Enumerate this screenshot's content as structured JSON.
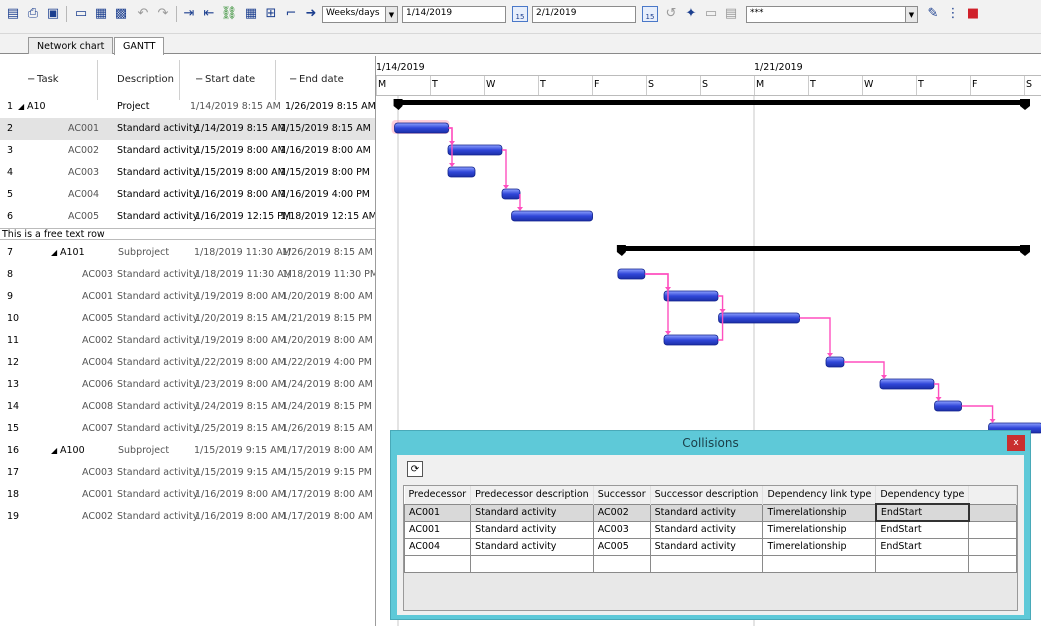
{
  "toolbar": {
    "icons": [
      "save-icon",
      "print-icon",
      "export-icon",
      "print-preview-icon",
      "page-setup-icon",
      "image-export-icon",
      "undo-icon",
      "redo-icon",
      "indent-icon",
      "outdent-icon",
      "link-icon",
      "table-icon",
      "network-icon",
      "dependency-icon",
      "arrow-icon"
    ],
    "timescale_value": "Weeks/days",
    "start_date": "1/14/2019",
    "end_date": "2/1/2019",
    "calendar_day": "15",
    "filter_value": "***"
  },
  "tabs": [
    {
      "label": "Network chart"
    },
    {
      "label": "GANTT"
    }
  ],
  "table": {
    "headers": {
      "task": "Task",
      "description": "Description",
      "start": "Start date",
      "end": "End date"
    },
    "rows": [
      {
        "num": "1",
        "task": "A10",
        "desc": "Project",
        "start": "1/14/2019 8:15 AM",
        "end": "1/26/2019 8:15 AM"
      },
      {
        "num": "2",
        "task": "AC001",
        "desc": "Standard activity",
        "start": "1/14/2019 8:15 AM",
        "end": "1/15/2019 8:15 AM"
      },
      {
        "num": "3",
        "task": "AC002",
        "desc": "Standard activity",
        "start": "1/15/2019 8:00 AM",
        "end": "1/16/2019 8:00 AM"
      },
      {
        "num": "4",
        "task": "AC003",
        "desc": "Standard activity",
        "start": "1/15/2019 8:00 AM",
        "end": "1/15/2019 8:00 PM"
      },
      {
        "num": "5",
        "task": "AC004",
        "desc": "Standard activity",
        "start": "1/16/2019 8:00 AM",
        "end": "1/16/2019 4:00 PM"
      },
      {
        "num": "6",
        "task": "AC005",
        "desc": "Standard activity",
        "start": "1/16/2019 12:15 PM",
        "end": "1/18/2019 12:15 AM"
      },
      {
        "num": "7",
        "task": "A101",
        "desc": "Subproject",
        "start": "1/18/2019 11:30 AM",
        "end": "1/26/2019 8:15 AM"
      },
      {
        "num": "8",
        "task": "AC003",
        "desc": "Standard activity",
        "start": "1/18/2019 11:30 AM",
        "end": "1/18/2019 11:30 PM"
      },
      {
        "num": "9",
        "task": "AC001",
        "desc": "Standard activity",
        "start": "1/19/2019 8:00 AM",
        "end": "1/20/2019 8:00 AM"
      },
      {
        "num": "10",
        "task": "AC005",
        "desc": "Standard activity",
        "start": "1/20/2019 8:15 AM",
        "end": "1/21/2019 8:15 PM"
      },
      {
        "num": "11",
        "task": "AC002",
        "desc": "Standard activity",
        "start": "1/19/2019 8:00 AM",
        "end": "1/20/2019 8:00 AM"
      },
      {
        "num": "12",
        "task": "AC004",
        "desc": "Standard activity",
        "start": "1/22/2019 8:00 AM",
        "end": "1/22/2019 4:00 PM"
      },
      {
        "num": "13",
        "task": "AC006",
        "desc": "Standard activity",
        "start": "1/23/2019 8:00 AM",
        "end": "1/24/2019 8:00 AM"
      },
      {
        "num": "14",
        "task": "AC008",
        "desc": "Standard activity",
        "start": "1/24/2019 8:15 AM",
        "end": "1/24/2019 8:15 PM"
      },
      {
        "num": "15",
        "task": "AC007",
        "desc": "Standard activity",
        "start": "1/25/2019 8:15 AM",
        "end": "1/26/2019 8:15 AM"
      },
      {
        "num": "16",
        "task": "A100",
        "desc": "Subproject",
        "start": "1/15/2019 9:15 AM",
        "end": "1/17/2019 8:00 AM"
      },
      {
        "num": "17",
        "task": "AC003",
        "desc": "Standard activity",
        "start": "1/15/2019 9:15 AM",
        "end": "1/15/2019 9:15 PM"
      },
      {
        "num": "18",
        "task": "AC001",
        "desc": "Standard activity",
        "start": "1/16/2019 8:00 AM",
        "end": "1/17/2019 8:00 AM"
      },
      {
        "num": "19",
        "task": "AC002",
        "desc": "Standard activity",
        "start": "1/16/2019 8:00 AM",
        "end": "1/17/2019 8:00 AM"
      }
    ],
    "free_text_row": "This is a free text row"
  },
  "timescale": {
    "weeks": [
      "1/14/2019",
      "1/21/2019"
    ],
    "days": [
      "M",
      "T",
      "W",
      "T",
      "F",
      "S",
      "S",
      "M",
      "T",
      "W",
      "T",
      "F",
      "S"
    ]
  },
  "collisions": {
    "title": "Collisions",
    "close_label": "x",
    "headers": [
      "Predecessor",
      "Predecessor description",
      "Successor",
      "Successor description",
      "Dependency link type",
      "Dependency type"
    ],
    "rows": [
      [
        "AC001",
        "Standard activity",
        "AC002",
        "Standard activity",
        "Timerelationship",
        "EndStart"
      ],
      [
        "AC001",
        "Standard activity",
        "AC003",
        "Standard activity",
        "Timerelationship",
        "EndStart"
      ],
      [
        "AC004",
        "Standard activity",
        "AC005",
        "Standard activity",
        "Timerelationship",
        "EndStart"
      ]
    ]
  },
  "colors": {
    "bar_fill": "#3047d9",
    "bar_highlight": "#8fa2ff",
    "summary_bar": "#000000",
    "link_line": "#ff4fbf",
    "dialog_bg": "#5ec9d8",
    "close_button": "#c92f2f"
  }
}
